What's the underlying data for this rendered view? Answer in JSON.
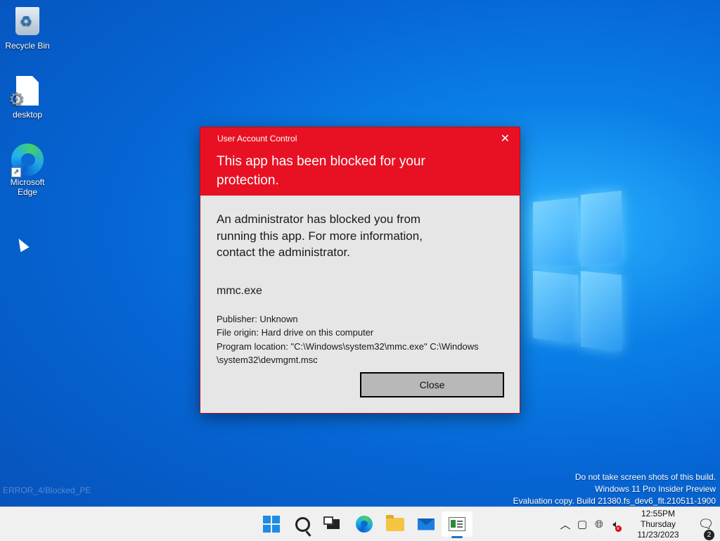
{
  "desktop": {
    "icons": [
      {
        "label": "Recycle Bin",
        "icon": "recycle-bin-icon"
      },
      {
        "label": "desktop",
        "icon": "settings-file-icon"
      },
      {
        "label": "Microsoft Edge",
        "icon": "edge-icon"
      }
    ],
    "faint_text": "ERROR_4/Blocked_PE"
  },
  "dialog": {
    "caption": "User Account Control",
    "headline": "This app has been blocked for your protection.",
    "message": "An administrator has blocked you from running this app. For more information, contact the administrator.",
    "program_name": "mmc.exe",
    "publisher": "Publisher: Unknown",
    "file_origin": "File origin: Hard drive on this computer",
    "program_location": "Program location: \"C:\\Windows\\system32\\mmc.exe\" C:\\Windows \\system32\\devmgmt.msc",
    "close_button": "Close",
    "header_color": "#e81123"
  },
  "watermark": {
    "line1": "Do not take screen shots of this build.",
    "line2": "Windows 11 Pro Insider Preview",
    "line3": "Evaluation copy. Build 21380.fs_dev6_flt.210511-1900"
  },
  "taskbar": {
    "apps": [
      "start-icon",
      "search-icon",
      "task-view-icon",
      "edge-icon",
      "file-explorer-icon",
      "mail-icon",
      "mmc-icon"
    ],
    "active_app": "mmc-icon",
    "clock": {
      "time": "12:55PM",
      "day": "Thursday",
      "date": "11/23/2023"
    },
    "notification_count": "2"
  }
}
